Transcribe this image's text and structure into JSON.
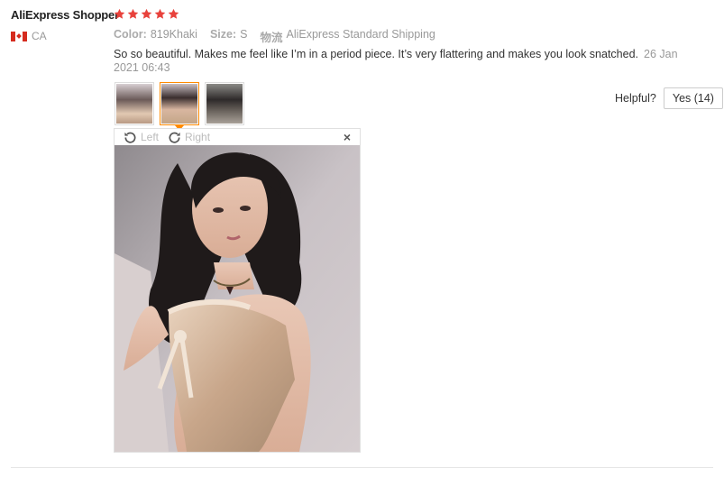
{
  "review": {
    "reviewer_name": "AliExpress Shopper",
    "rating": 5,
    "country_code": "CA",
    "color_label": "Color:",
    "color_value": "819Khaki",
    "size_label": "Size:",
    "size_value": "S",
    "shipping_label": "物流",
    "shipping_value": "AliExpress Standard Shipping",
    "text": "So so beautiful. Makes me feel like I’m in a period piece. It’s very flattering and makes you look snatched.",
    "date": "26 Jan 2021 06:43",
    "helpful_label": "Helpful?",
    "yes_label": "Yes (14)"
  },
  "thumbnails": [
    {
      "active": false
    },
    {
      "active": true
    },
    {
      "active": false
    }
  ],
  "viewer": {
    "left_label": "Left",
    "right_label": "Right",
    "close_symbol": "×"
  },
  "colors": {
    "star": "#e8423c",
    "active_border": "#ff8a00"
  },
  "icons": [
    "star-icon",
    "flag-ca-icon",
    "rotate-left-icon",
    "rotate-right-icon",
    "close-icon"
  ]
}
